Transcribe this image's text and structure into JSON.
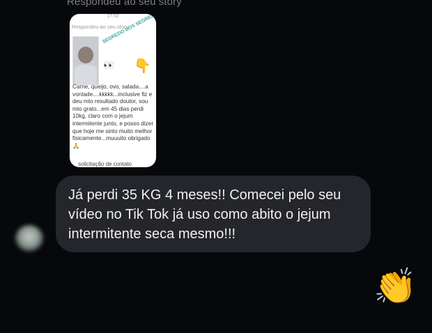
{
  "header": {
    "label": "Respondeu ao seu story"
  },
  "story": {
    "time": "17:52",
    "reply_label": "Respondeu ao seu story",
    "overlay_text": "SEGREDO DOS SEGREDOS",
    "eyes_emoji": "👀",
    "pointing_emoji": "👇",
    "body_text": "Carne, queijo, ovo, salada....a vontade....kkkkk...inclusive fiz e deu mto resultado doutor, sou mto grato...em 45 dias perdi 10kg, claro com o jejum intermitente junto, e posso dizer que hoje me sinto muito melhor fisicamente...muuuito obrigado🙏",
    "footer_text": "solicitação de contato"
  },
  "message": {
    "text": "Já perdi 35 KG 4 meses!! Comecei pelo seu vídeo no Tik Tok já uso como abito o jejum intermitente seca mesmo!!!"
  },
  "reaction": {
    "emoji": "👏"
  }
}
